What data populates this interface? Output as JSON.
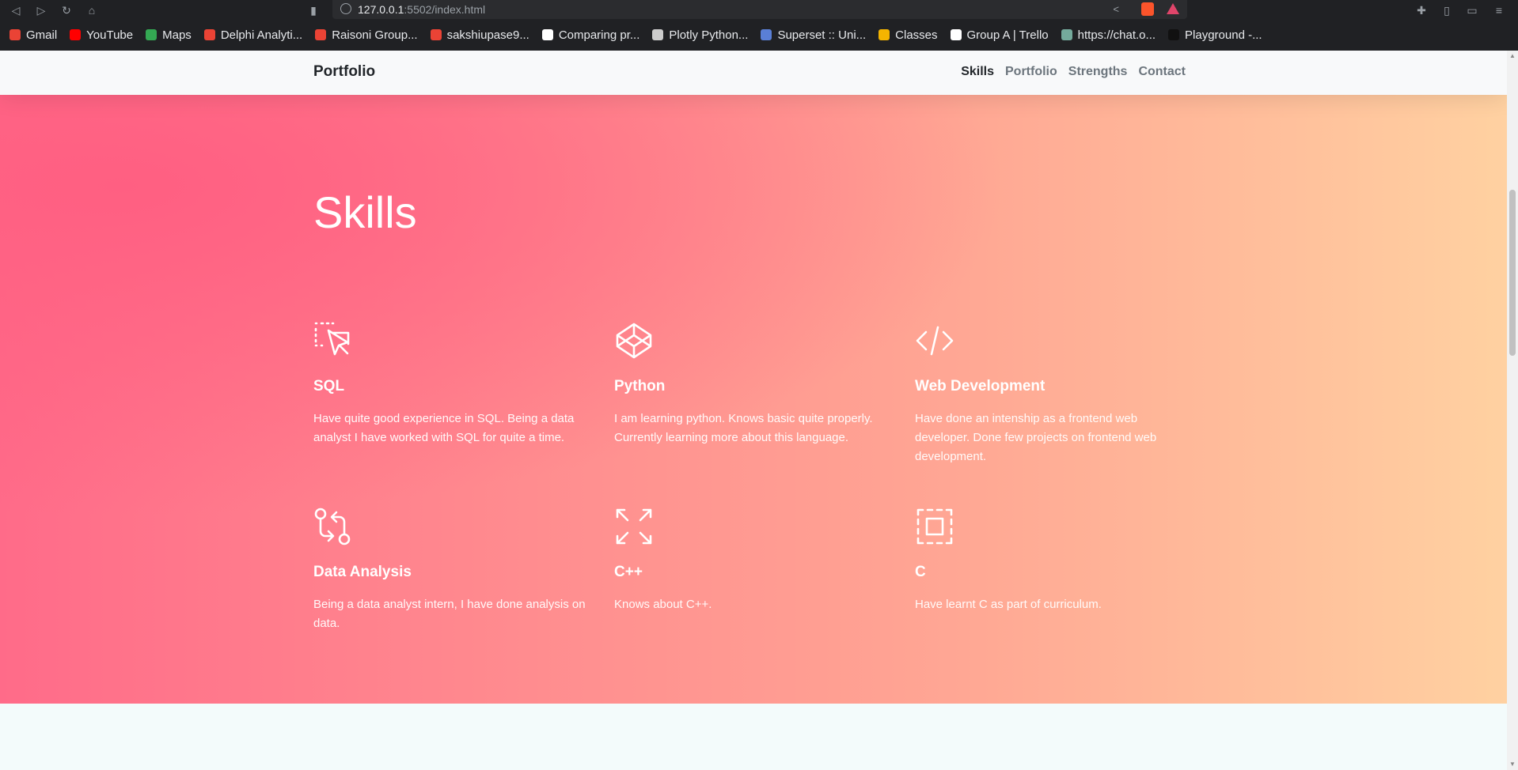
{
  "browser": {
    "url_host": "127.0.0.1",
    "url_path": ":5502/index.html",
    "bookmarks": [
      {
        "label": "Gmail",
        "icon": "gmail-icon",
        "color": "#ea4335"
      },
      {
        "label": "YouTube",
        "icon": "youtube-icon",
        "color": "#ff0000"
      },
      {
        "label": "Maps",
        "icon": "maps-icon",
        "color": "#34a853"
      },
      {
        "label": "Delphi Analyti...",
        "icon": "gmail-icon",
        "color": "#ea4335"
      },
      {
        "label": "Raisoni Group...",
        "icon": "gmail-icon",
        "color": "#ea4335"
      },
      {
        "label": "sakshiupase9...",
        "icon": "gmail-icon",
        "color": "#ea4335"
      },
      {
        "label": "Comparing pr...",
        "icon": "github-icon",
        "color": "#ffffff"
      },
      {
        "label": "Plotly Python...",
        "icon": "globe-icon",
        "color": "#cccccc"
      },
      {
        "label": "Superset :: Uni...",
        "icon": "superset-icon",
        "color": "#5a7fd6"
      },
      {
        "label": "Classes",
        "icon": "classroom-icon",
        "color": "#f4b400"
      },
      {
        "label": "Group A | Trello",
        "icon": "trello-icon",
        "color": "#ffffff"
      },
      {
        "label": "https://chat.o...",
        "icon": "openai-icon",
        "color": "#74aa9c"
      },
      {
        "label": "Playground -...",
        "icon": "openai-icon",
        "color": "#111111"
      }
    ]
  },
  "navbar": {
    "brand": "Portfolio",
    "links": [
      "Skills",
      "Portfolio",
      "Strengths",
      "Contact"
    ]
  },
  "skills": {
    "title": "Skills",
    "items": [
      {
        "icon": "cursor-select-icon",
        "title": "SQL",
        "desc": "Have quite good experience in SQL. Being a data analyst I have worked with SQL for quite a time."
      },
      {
        "icon": "codepen-icon",
        "title": "Python",
        "desc": "I am learning python. Knows basic quite properly. Currently learning more about this language."
      },
      {
        "icon": "code-icon",
        "title": "Web Development",
        "desc": "Have done an intenship as a frontend web developer. Done few projects on frontend web development."
      },
      {
        "icon": "git-compare-icon",
        "title": "Data Analysis",
        "desc": "Being a data analyst intern, I have done analysis on data."
      },
      {
        "icon": "maximize-icon",
        "title": "C++",
        "desc": "Knows about C++."
      },
      {
        "icon": "box-select-icon",
        "title": "C",
        "desc": "Have learnt C as part of curriculum."
      }
    ]
  }
}
